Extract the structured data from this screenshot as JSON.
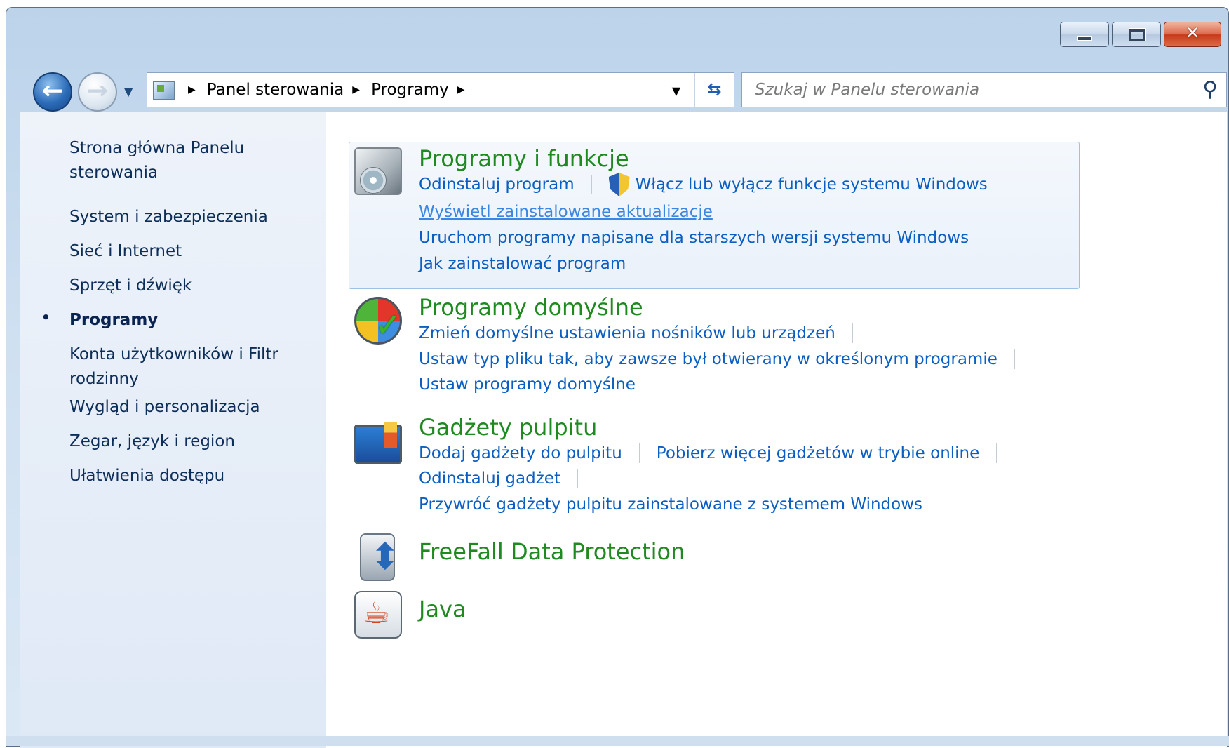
{
  "window": {
    "controls": {
      "minimize": "minimize",
      "maximize": "maximize",
      "close": "close"
    }
  },
  "navigation": {
    "back_icon": "back-arrow-icon",
    "forward_icon": "forward-arrow-icon",
    "breadcrumbs": [
      "Panel sterowania",
      "Programy"
    ],
    "search_placeholder": "Szukaj w Panelu sterowania"
  },
  "sidebar": {
    "items": [
      {
        "label": "Strona główna Panelu sterowania"
      },
      {
        "label": "System i zabezpieczenia"
      },
      {
        "label": "Sieć i Internet"
      },
      {
        "label": "Sprzęt i dźwięk"
      },
      {
        "label": "Programy",
        "current": true
      },
      {
        "label": "Konta użytkowników i Filtr rodzinny"
      },
      {
        "label": "Wygląd i personalizacja"
      },
      {
        "label": "Zegar, język i region"
      },
      {
        "label": "Ułatwienia dostępu"
      }
    ]
  },
  "categories": [
    {
      "title": "Programy i funkcje",
      "icon": "programs-and-features-icon",
      "links": [
        "Odinstaluj program",
        "Włącz lub wyłącz funkcje systemu Windows",
        "Wyświetl zainstalowane aktualizacje",
        "Uruchom programy napisane dla starszych wersji systemu Windows",
        "Jak zainstalować program"
      ]
    },
    {
      "title": "Programy domyślne",
      "icon": "default-programs-icon",
      "links": [
        "Zmień domyślne ustawienia nośników lub urządzeń",
        "Ustaw typ pliku tak, aby zawsze był otwierany w określonym programie",
        "Ustaw programy domyślne"
      ]
    },
    {
      "title": "Gadżety pulpitu",
      "icon": "desktop-gadgets-icon",
      "links": [
        "Dodaj gadżety do pulpitu",
        "Pobierz więcej gadżetów w trybie online",
        "Odinstaluj gadżet",
        "Przywróć gadżety pulpitu zainstalowane z systemem Windows"
      ]
    },
    {
      "title": "FreeFall Data Protection",
      "icon": "freefall-icon",
      "links": []
    },
    {
      "title": "Java",
      "icon": "java-icon",
      "links": []
    }
  ]
}
